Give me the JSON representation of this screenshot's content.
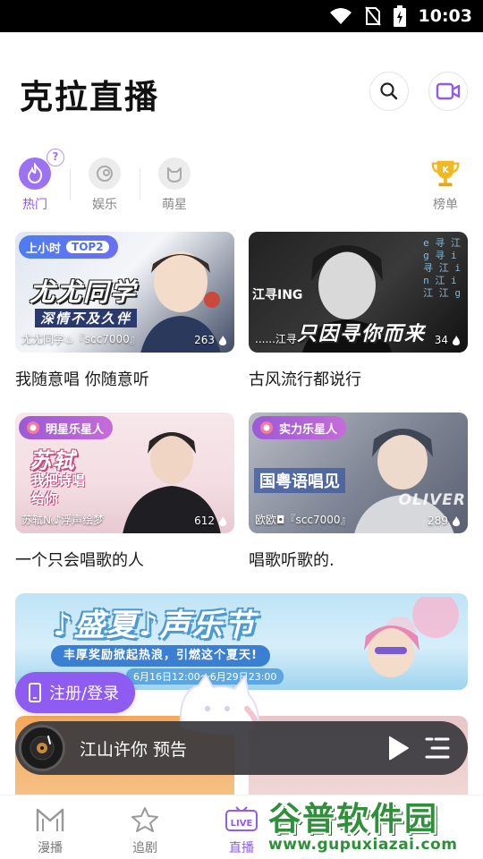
{
  "status_bar": {
    "time": "10:03"
  },
  "header": {
    "title": "克拉直播"
  },
  "categories": [
    {
      "label": "热门",
      "active": true
    },
    {
      "label": "娱乐",
      "active": false
    },
    {
      "label": "萌星",
      "active": false
    },
    {
      "label": "榜单",
      "active": false
    }
  ],
  "help_badge": "?",
  "rooms": [
    {
      "tag": "上小时",
      "tag2": "TOP2",
      "big_text": "尤尤同学",
      "sub_text": "深情不及久伴",
      "host": "尤尤同学♨『scc7000』",
      "viewers": "263",
      "caption": "我随意唱 你随意听"
    },
    {
      "tag": "",
      "big_text": "只因寻你而来",
      "side_text": "江寻ING",
      "host": "......江寻",
      "viewers": "34",
      "caption": "古风流行都说行"
    },
    {
      "tag": "明星乐星人",
      "big_text": "苏轼",
      "sub_text": "我把诗唱给你",
      "host": "苏轼№♪浮声绘梦",
      "viewers": "612",
      "caption": "一个只会唱歌的人"
    },
    {
      "tag": "实力乐星人",
      "big_text": "国粤语唱见",
      "side_text": "OLIVER",
      "host": "欧欧◘『scc7000』",
      "viewers": "289",
      "caption": "唱歌听歌的."
    }
  ],
  "banner": {
    "title": "♪盛夏♪声乐节",
    "subtitle": "丰厚奖励掀起热浪，引燃这个夏天!",
    "date": "6月16日12:00～6月29日23:00"
  },
  "register_button": "注册/登录",
  "player": {
    "title": "江山许你 预告"
  },
  "bottom_nav": [
    {
      "label": "漫播",
      "active": false
    },
    {
      "label": "追剧",
      "active": false
    },
    {
      "label": "直播",
      "active": true
    }
  ],
  "watermark": {
    "main": "谷普软件园",
    "url": "www.gupuxiazai.com"
  },
  "colors": {
    "accent": "#8e5cf0",
    "player_bg": "#3a3a3e",
    "gold": "#f2b821"
  }
}
